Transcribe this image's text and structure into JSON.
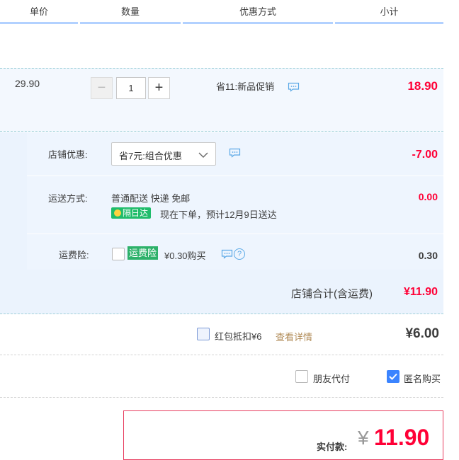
{
  "header": {
    "col_unit_price": "单价",
    "col_quantity": "数量",
    "col_promo": "优惠方式",
    "col_subtotal": "小计"
  },
  "item": {
    "unit_price": "29.90",
    "quantity": "1",
    "decrement_symbol": "−",
    "increment_symbol": "+",
    "promo_text": "省11:新品促销",
    "subtotal": "18.90"
  },
  "shop": {
    "discount_label": "店铺优惠:",
    "discount_select_value": "省7元:组合优惠",
    "discount_amount": "-7.00",
    "shipping_label": "运送方式:",
    "shipping_method": "普通配送 快递 免邮",
    "next_day_badge": "隔日达",
    "delivery_estimate": "现在下单，预计12月9日送达",
    "shipping_amount": "0.00",
    "insurance_label": "运费险:",
    "insurance_tag": "运费险",
    "insurance_price": "¥0.30购买",
    "insurance_amount": "0.30",
    "insurance_help_symbol": "?",
    "total_label": "店铺合计(含运费)",
    "total_amount": "¥11.90"
  },
  "red_packet": {
    "label": "红包抵扣¥6",
    "details_link": "查看详情",
    "amount": "¥6.00"
  },
  "options": {
    "friend_pay": "朋友代付",
    "friend_pay_checked": false,
    "anonymous": "匿名购买",
    "anonymous_checked": true
  },
  "payment": {
    "label": "实付款:",
    "currency": "¥",
    "amount": "11.90"
  },
  "colors": {
    "accent_red": "#ff0036",
    "header_blue": "#b2d1ff",
    "green": "#1fbc6b",
    "checkbox_blue": "#3b84ff"
  },
  "icons": {
    "chat": "chat-bubble-icon",
    "help": "question-circle-icon",
    "dropdown": "chevron-down-icon",
    "lightning": "lightning-icon",
    "checkmark": "checkmark-icon"
  }
}
